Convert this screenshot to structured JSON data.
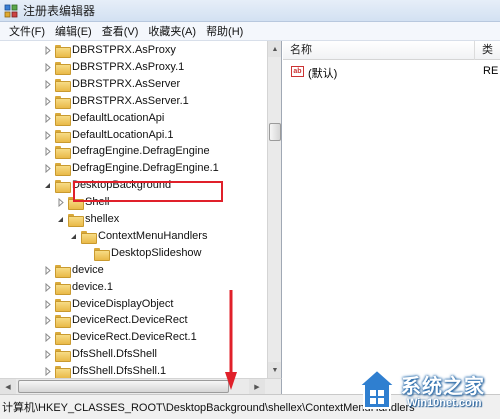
{
  "window": {
    "title": "注册表编辑器"
  },
  "menu": [
    "文件(F)",
    "编辑(E)",
    "查看(V)",
    "收藏夹(A)",
    "帮助(H)"
  ],
  "tree": [
    {
      "label": "DBRSTPRX.AsProxy",
      "level": 0,
      "expander": "collapsed"
    },
    {
      "label": "DBRSTPRX.AsProxy.1",
      "level": 0,
      "expander": "collapsed"
    },
    {
      "label": "DBRSTPRX.AsServer",
      "level": 0,
      "expander": "collapsed"
    },
    {
      "label": "DBRSTPRX.AsServer.1",
      "level": 0,
      "expander": "collapsed"
    },
    {
      "label": "DefaultLocationApi",
      "level": 0,
      "expander": "collapsed"
    },
    {
      "label": "DefaultLocationApi.1",
      "level": 0,
      "expander": "collapsed"
    },
    {
      "label": "DefragEngine.DefragEngine",
      "level": 0,
      "expander": "collapsed"
    },
    {
      "label": "DefragEngine.DefragEngine.1",
      "level": 0,
      "expander": "collapsed"
    },
    {
      "label": "DesktopBackground",
      "level": 0,
      "expander": "expanded"
    },
    {
      "label": "Shell",
      "level": 1,
      "expander": "collapsed"
    },
    {
      "label": "shellex",
      "level": 1,
      "expander": "expanded"
    },
    {
      "label": "ContextMenuHandlers",
      "level": 2,
      "expander": "expanded",
      "selected": true
    },
    {
      "label": "DesktopSlideshow",
      "level": 3,
      "expander": "none"
    },
    {
      "label": "device",
      "level": 0,
      "expander": "collapsed"
    },
    {
      "label": "device.1",
      "level": 0,
      "expander": "collapsed"
    },
    {
      "label": "DeviceDisplayObject",
      "level": 0,
      "expander": "collapsed"
    },
    {
      "label": "DeviceRect.DeviceRect",
      "level": 0,
      "expander": "collapsed"
    },
    {
      "label": "DeviceRect.DeviceRect.1",
      "level": 0,
      "expander": "collapsed"
    },
    {
      "label": "DfsShell.DfsShell",
      "level": 0,
      "expander": "collapsed"
    },
    {
      "label": "DfsShell.DfsShell.1",
      "level": 0,
      "expander": "collapsed"
    }
  ],
  "list": {
    "columns": [
      "名称",
      "类"
    ],
    "rows": [
      {
        "icon": "ab",
        "name": "(默认)",
        "type": "RE"
      }
    ]
  },
  "status": {
    "path": "计算机\\HKEY_CLASSES_ROOT\\DesktopBackground\\shellex\\ContextMenuHandlers"
  },
  "watermark": {
    "title": "系统之家",
    "url": "Win10net.com"
  },
  "colors": {
    "highlight": "#e0202a",
    "arrow": "#e0202a",
    "folder": "#f0c65a"
  }
}
